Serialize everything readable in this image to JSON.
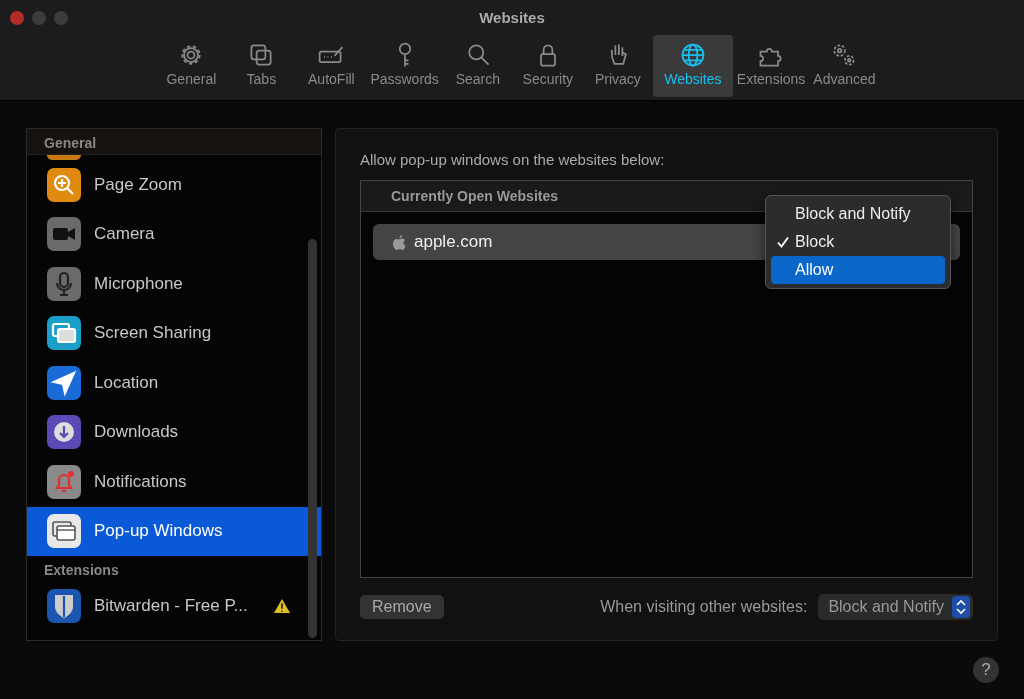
{
  "window": {
    "title": "Websites"
  },
  "toolbar": [
    {
      "label": "General",
      "selected": false
    },
    {
      "label": "Tabs",
      "selected": false
    },
    {
      "label": "AutoFill",
      "selected": false
    },
    {
      "label": "Passwords",
      "selected": false
    },
    {
      "label": "Search",
      "selected": false
    },
    {
      "label": "Security",
      "selected": false
    },
    {
      "label": "Privacy",
      "selected": false
    },
    {
      "label": "Websites",
      "selected": true
    },
    {
      "label": "Extensions",
      "selected": false
    },
    {
      "label": "Advanced",
      "selected": false
    }
  ],
  "sidebar": {
    "sections": [
      {
        "header": "General",
        "items": [
          {
            "label": "Page Zoom",
            "selected": false,
            "warning": false
          },
          {
            "label": "Camera",
            "selected": false,
            "warning": false
          },
          {
            "label": "Microphone",
            "selected": false,
            "warning": false
          },
          {
            "label": "Screen Sharing",
            "selected": false,
            "warning": false
          },
          {
            "label": "Location",
            "selected": false,
            "warning": false
          },
          {
            "label": "Downloads",
            "selected": false,
            "warning": false
          },
          {
            "label": "Notifications",
            "selected": false,
            "warning": false
          },
          {
            "label": "Pop-up Windows",
            "selected": true,
            "warning": false
          }
        ]
      },
      {
        "header": "Extensions",
        "items": [
          {
            "label": "Bitwarden - Free P...",
            "selected": false,
            "warning": true
          }
        ]
      }
    ]
  },
  "panel": {
    "heading": "Allow pop-up windows on the websites below:",
    "table": {
      "header": "Currently Open Websites",
      "rows": [
        {
          "site": "apple.com"
        }
      ]
    },
    "popup_menu": {
      "items": [
        {
          "label": "Block and Notify",
          "checked": false,
          "selected": false
        },
        {
          "label": "Block",
          "checked": true,
          "selected": false
        },
        {
          "label": "Allow",
          "checked": false,
          "selected": true
        }
      ]
    },
    "remove_button": "Remove",
    "default_policy": {
      "label": "When visiting other websites:",
      "value": "Block and Notify"
    }
  },
  "help_button": "?"
}
